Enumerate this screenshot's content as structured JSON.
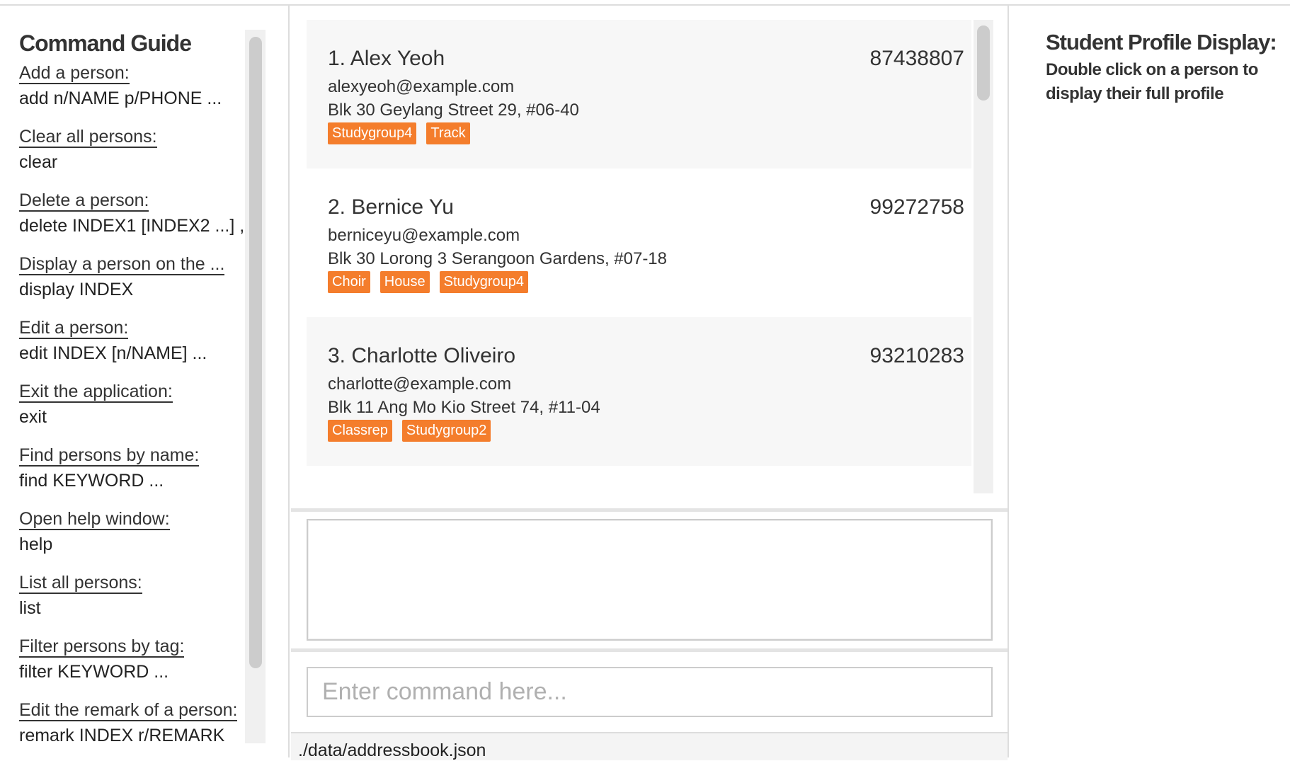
{
  "guide": {
    "title": "Command Guide",
    "items": [
      {
        "title": "Add a person:",
        "command": "add n/NAME p/PHONE ..."
      },
      {
        "title": "Clear all persons:",
        "command": "clear"
      },
      {
        "title": "Delete a person:",
        "command": "delete INDEX1 [INDEX2 ...] ,"
      },
      {
        "title": "Display a person on the ...",
        "command": "display INDEX"
      },
      {
        "title": "Edit a person:",
        "command": "edit INDEX [n/NAME] ..."
      },
      {
        "title": "Exit the application:",
        "command": "exit"
      },
      {
        "title": "Find persons by name:",
        "command": "find KEYWORD ..."
      },
      {
        "title": "Open help window:",
        "command": "help"
      },
      {
        "title": "List all persons:",
        "command": "list"
      },
      {
        "title": "Filter persons by tag:",
        "command": "filter KEYWORD ..."
      },
      {
        "title": "Edit the remark of a person:",
        "command": "remark INDEX r/REMARK"
      }
    ]
  },
  "persons": [
    {
      "name": "1. Alex Yeoh",
      "phone": "87438807",
      "email": "alexyeoh@example.com",
      "address": "Blk 30 Geylang Street 29, #06-40",
      "tags": [
        "Studygroup4",
        "Track"
      ]
    },
    {
      "name": "2. Bernice Yu",
      "phone": "99272758",
      "email": "berniceyu@example.com",
      "address": "Blk 30 Lorong 3 Serangoon Gardens, #07-18",
      "tags": [
        "Choir",
        "House",
        "Studygroup4"
      ]
    },
    {
      "name": "3. Charlotte Oliveiro",
      "phone": "93210283",
      "email": "charlotte@example.com",
      "address": "Blk 11 Ang Mo Kio Street 74, #11-04",
      "tags": [
        "Classrep",
        "Studygroup2"
      ]
    }
  ],
  "result": {
    "text": ""
  },
  "command": {
    "placeholder": "Enter command here...",
    "value": ""
  },
  "status": {
    "path": "./data/addressbook.json"
  },
  "profile": {
    "title": "Student Profile Display:",
    "hint": "Double click on a person to display their full profile"
  },
  "colors": {
    "tag": "#f47d2c"
  }
}
